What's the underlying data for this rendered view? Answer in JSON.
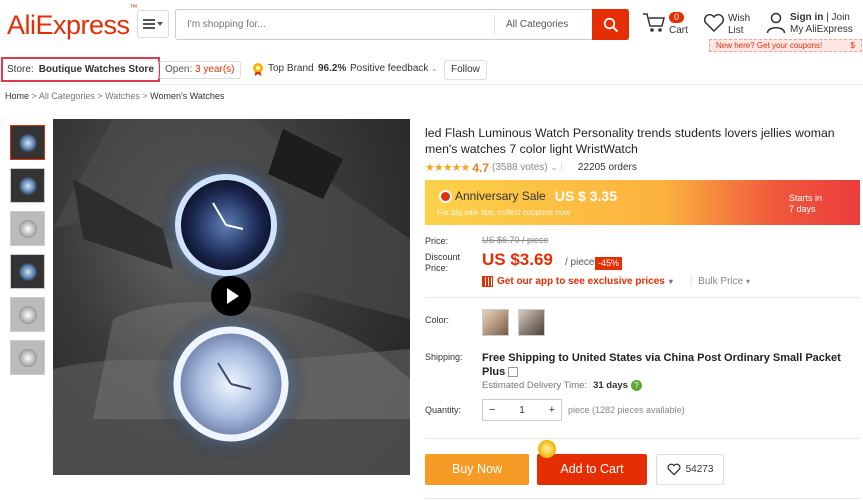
{
  "header": {
    "logo": "AliExpress",
    "logo_mark": "™",
    "search_placeholder": "I'm shopping for...",
    "category": "All Categories",
    "cart_count": "0",
    "cart_label": "Cart",
    "wish_label_1": "Wish",
    "wish_label_2": "List",
    "signin": "Sign in",
    "sep": "|",
    "join": "Join",
    "my_ali": "My AliExpress",
    "coupon": "New here? Get your coupons!",
    "coupon_sign": "$"
  },
  "store": {
    "label": "Store:",
    "name": "Boutique Watches Store",
    "open_label": "Open:",
    "open_years": "3 year(s)",
    "top_brand": "Top Brand",
    "feedback_pct": "96.2%",
    "feedback_label": "Positive feedback",
    "follow": "Follow"
  },
  "breadcrumb": {
    "home": "Home",
    "sep": ">",
    "c1": "All Categories",
    "c2": "Watches",
    "c3": "Women's Watches"
  },
  "product": {
    "title": "led Flash Luminous Watch Personality trends students lovers jellies woman men's watches 7 color light WristWatch",
    "stars": "★★★★★",
    "rating": "4.7",
    "votes": "(3588 votes)",
    "orders": "22205 orders",
    "sale_label": "Anniversary Sale",
    "sale_price": "US $ 3.35",
    "sale_sub": "For big sale tips, collect coupons now",
    "starts_in": "Starts in",
    "starts_days": "7 days",
    "price_label": "Price:",
    "old_price": "US $6.70 / piece",
    "discount_label_1": "Discount",
    "discount_label_2": "Price:",
    "new_price": "US $3.69",
    "unit": "/ piece",
    "discount_pct": "-45%",
    "app_text": "Get our app to see exclusive prices",
    "bulk": "Bulk Price",
    "color_label": "Color:",
    "shipping_label": "Shipping:",
    "shipping_text": "Free Shipping to United States via China Post Ordinary Small Packet Plus",
    "delivery_label": "Estimated Delivery Time:",
    "delivery_days": "31 days",
    "help_mark": "?",
    "quantity_label": "Quantity:",
    "qty_minus": "−",
    "qty_value": "1",
    "qty_plus": "+",
    "pieces": "piece (1282 pieces available)",
    "buy_now": "Buy Now",
    "add_to_cart": "Add to Cart",
    "wish_count": "54273"
  },
  "colors": {
    "brand": "#e62e04",
    "buy": "#f79b27"
  }
}
